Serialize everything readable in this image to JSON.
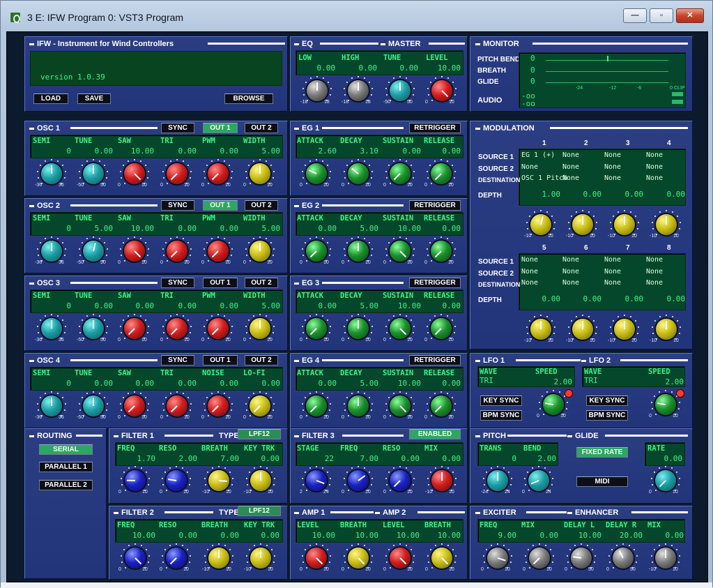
{
  "window": {
    "title": "3 E: IFW Program 0: VST3 Program",
    "minimize_glyph": "—",
    "maximize_glyph": "▫",
    "close_glyph": "✕"
  },
  "ifw": {
    "title": "IFW - Instrument for Wind Controllers",
    "version": "version 1.0.39",
    "load": "LOAD",
    "save": "SAVE",
    "browse": "BROWSE"
  },
  "eq": {
    "title": "EQ",
    "master_title": "MASTER",
    "labels": [
      "LOW",
      "HIGH",
      "TUNE",
      "LEVEL"
    ],
    "values": [
      "0.00",
      "0.00",
      "0.00",
      "10.00"
    ],
    "ticks": [
      [
        "-18",
        "18"
      ],
      [
        "-18",
        "18"
      ],
      [
        "-50",
        "50"
      ],
      [
        "0",
        "10"
      ]
    ]
  },
  "monitor": {
    "title": "MONITOR",
    "rows": [
      "PITCH BEND",
      "BREATH",
      "GLIDE",
      "AUDIO"
    ],
    "pitch": "0",
    "breath": "0",
    "glide": "0",
    "audio1": "-oo",
    "audio2": "-oo",
    "scale": [
      "-24",
      "-12",
      "-6",
      "0"
    ],
    "clip": "CLIP"
  },
  "osc": [
    {
      "title": "OSC 1",
      "sync": "SYNC",
      "out1": "OUT 1",
      "out2": "OUT 2",
      "labels": [
        "SEMI",
        "TUNE",
        "SAW",
        "TRI",
        "PWM",
        "WIDTH"
      ],
      "values": [
        "0",
        "0.00",
        "10.00",
        "0.00",
        "0.00",
        "5.00"
      ],
      "ticks": [
        [
          "-36",
          "36"
        ],
        [
          "-50",
          "50"
        ],
        [
          "0",
          "10"
        ],
        [
          "0",
          "10"
        ],
        [
          "0",
          "10"
        ],
        [
          "0",
          "10"
        ]
      ]
    },
    {
      "title": "OSC 2",
      "sync": "SYNC",
      "out1": "OUT 1",
      "out2": "OUT 2",
      "labels": [
        "SEMI",
        "TUNE",
        "SAW",
        "TRI",
        "PWM",
        "WIDTH"
      ],
      "values": [
        "0",
        "5.00",
        "10.00",
        "0.00",
        "0.00",
        "5.00"
      ],
      "ticks": [
        [
          "-36",
          "36"
        ],
        [
          "-50",
          "50"
        ],
        [
          "0",
          "10"
        ],
        [
          "0",
          "10"
        ],
        [
          "0",
          "10"
        ],
        [
          "0",
          "10"
        ]
      ]
    },
    {
      "title": "OSC 3",
      "sync": "SYNC",
      "out1": "OUT 1",
      "out2": "OUT 2",
      "labels": [
        "SEMI",
        "TUNE",
        "SAW",
        "TRI",
        "PWM",
        "WIDTH"
      ],
      "values": [
        "0",
        "0.00",
        "0.00",
        "0.00",
        "0.00",
        "5.00"
      ],
      "ticks": [
        [
          "-36",
          "36"
        ],
        [
          "-50",
          "50"
        ],
        [
          "0",
          "10"
        ],
        [
          "0",
          "10"
        ],
        [
          "0",
          "10"
        ],
        [
          "0",
          "10"
        ]
      ]
    },
    {
      "title": "OSC 4",
      "sync": "SYNC",
      "out1": "OUT 1",
      "out2": "OUT 2",
      "labels": [
        "SEMI",
        "TUNE",
        "SAW",
        "TRI",
        "NOISE",
        "LO-FI"
      ],
      "values": [
        "0",
        "0.00",
        "0.00",
        "0.00",
        "0.00",
        "0.00"
      ],
      "ticks": [
        [
          "-36",
          "36"
        ],
        [
          "-50",
          "50"
        ],
        [
          "0",
          "10"
        ],
        [
          "0",
          "10"
        ],
        [
          "0",
          "10"
        ],
        [
          "0",
          "10"
        ]
      ]
    }
  ],
  "eg": [
    {
      "title": "EG 1",
      "retrigger": "RETRIGGER",
      "labels": [
        "ATTACK",
        "DECAY",
        "SUSTAIN",
        "RELEASE"
      ],
      "values": [
        "2.60",
        "3.10",
        "0.00",
        "0.00"
      ]
    },
    {
      "title": "EG 2",
      "retrigger": "RETRIGGER",
      "labels": [
        "ATTACK",
        "DECAY",
        "SUSTAIN",
        "RELEASE"
      ],
      "values": [
        "0.00",
        "5.00",
        "10.00",
        "0.00"
      ]
    },
    {
      "title": "EG 3",
      "retrigger": "RETRIGGER",
      "labels": [
        "ATTACK",
        "DECAY",
        "SUSTAIN",
        "RELEASE"
      ],
      "values": [
        "0.00",
        "5.00",
        "10.00",
        "0.00"
      ]
    },
    {
      "title": "EG 4",
      "retrigger": "RETRIGGER",
      "labels": [
        "ATTACK",
        "DECAY",
        "SUSTAIN",
        "RELEASE"
      ],
      "values": [
        "0.00",
        "5.00",
        "10.00",
        "0.00"
      ]
    }
  ],
  "eg_ticks": [
    [
      "0",
      "10"
    ],
    [
      "0",
      "10"
    ],
    [
      "0",
      "10"
    ],
    [
      "0",
      "10"
    ]
  ],
  "modulation": {
    "title": "MODULATION",
    "row_labels": [
      "SOURCE 1",
      "SOURCE 2",
      "DESTINATION",
      "DEPTH"
    ],
    "slots_a": {
      "nums": [
        "1",
        "2",
        "3",
        "4"
      ],
      "source1": [
        "EG 1 (+)",
        "None",
        "None",
        "None"
      ],
      "source2": [
        "None",
        "None",
        "None",
        "None"
      ],
      "dest": [
        "OSC 1 Pitch",
        "None",
        "None",
        "None"
      ],
      "depth": [
        "1.00",
        "0.00",
        "0.00",
        "0.00"
      ]
    },
    "slots_b": {
      "nums": [
        "5",
        "6",
        "7",
        "8"
      ],
      "source1": [
        "None",
        "None",
        "None",
        "None"
      ],
      "source2": [
        "None",
        "None",
        "None",
        "None"
      ],
      "dest": [
        "None",
        "None",
        "None",
        "None"
      ],
      "depth": [
        "0.00",
        "0.00",
        "0.00",
        "0.00"
      ]
    },
    "ticks": [
      "-10",
      "10"
    ]
  },
  "lfo": {
    "title1": "LFO 1",
    "title2": "LFO 2",
    "labels": [
      "WAVE",
      "SPEED",
      "WAVE",
      "SPEED"
    ],
    "wave1": "TRI",
    "speed1": "2.00",
    "wave2": "TRI",
    "speed2": "2.00",
    "keysync": "KEY SYNC",
    "bpmsync": "BPM SYNC",
    "ticks": [
      "0",
      "10"
    ]
  },
  "routing": {
    "title": "ROUTING",
    "serial": "SERIAL",
    "p1": "PARALLEL 1",
    "p2": "PARALLEL 2"
  },
  "filter1": {
    "title": "FILTER 1",
    "type_label": "TYPE",
    "type": "LPF12",
    "labels": [
      "FREQ",
      "RESO",
      "BREATH",
      "KEY TRK"
    ],
    "values": [
      "1.70",
      "2.00",
      "7.00",
      "0.00"
    ],
    "ticks": [
      [
        "0",
        "10"
      ],
      [
        "0",
        "10"
      ],
      [
        "-10",
        "10"
      ],
      [
        "-10",
        "10"
      ]
    ]
  },
  "filter2": {
    "title": "FILTER 2",
    "type_label": "TYPE",
    "type": "LPF12",
    "labels": [
      "FREQ",
      "RESO",
      "BREATH",
      "KEY TRK"
    ],
    "values": [
      "10.00",
      "0.00",
      "0.00",
      "0.00"
    ],
    "ticks": [
      [
        "0",
        "10"
      ],
      [
        "0",
        "10"
      ],
      [
        "-10",
        "10"
      ],
      [
        "-10",
        "10"
      ]
    ]
  },
  "filter3": {
    "title": "FILTER 3",
    "enabled": "ENABLED",
    "labels": [
      "STAGE",
      "FREQ",
      "RESO",
      "MIX"
    ],
    "values": [
      "22",
      "7.00",
      "0.00",
      "0.00"
    ],
    "ticks": [
      [
        "2",
        "24"
      ],
      [
        "0",
        "10"
      ],
      [
        "0",
        "10"
      ],
      [
        "-10",
        "10"
      ]
    ]
  },
  "amp": {
    "title1": "AMP 1",
    "title2": "AMP 2",
    "labels": [
      "LEVEL",
      "BREATH",
      "LEVEL",
      "BREATH"
    ],
    "values": [
      "10.00",
      "10.00",
      "10.00",
      "10.00"
    ],
    "ticks": [
      [
        "0",
        "10"
      ],
      [
        "0",
        "10"
      ],
      [
        "0",
        "10"
      ],
      [
        "0",
        "10"
      ]
    ]
  },
  "pitch": {
    "title": "PITCH",
    "glide_title": "GLIDE",
    "labels": [
      "TRANS",
      "BEND"
    ],
    "values": [
      "0",
      "2.00"
    ],
    "fixed": "FIXED RATE",
    "midi": "MIDI",
    "rate_label": "RATE",
    "rate": "0.00",
    "ticks": [
      [
        "-24",
        "24"
      ],
      [
        "0",
        "24"
      ],
      [
        "0",
        "10"
      ]
    ]
  },
  "exciter": {
    "title": "EXCITER",
    "enh_title": "ENHANCER",
    "labels": [
      "FREQ",
      "MIX",
      "DELAY L",
      "DELAY R",
      "MIX"
    ],
    "values": [
      "9.00",
      "0.00",
      "10.00",
      "20.00",
      "0.00"
    ],
    "ticks": [
      [
        "0",
        "10"
      ],
      [
        "0",
        "10"
      ],
      [
        "0",
        "50"
      ],
      [
        "0",
        "50"
      ],
      [
        "-10",
        "10"
      ]
    ]
  }
}
